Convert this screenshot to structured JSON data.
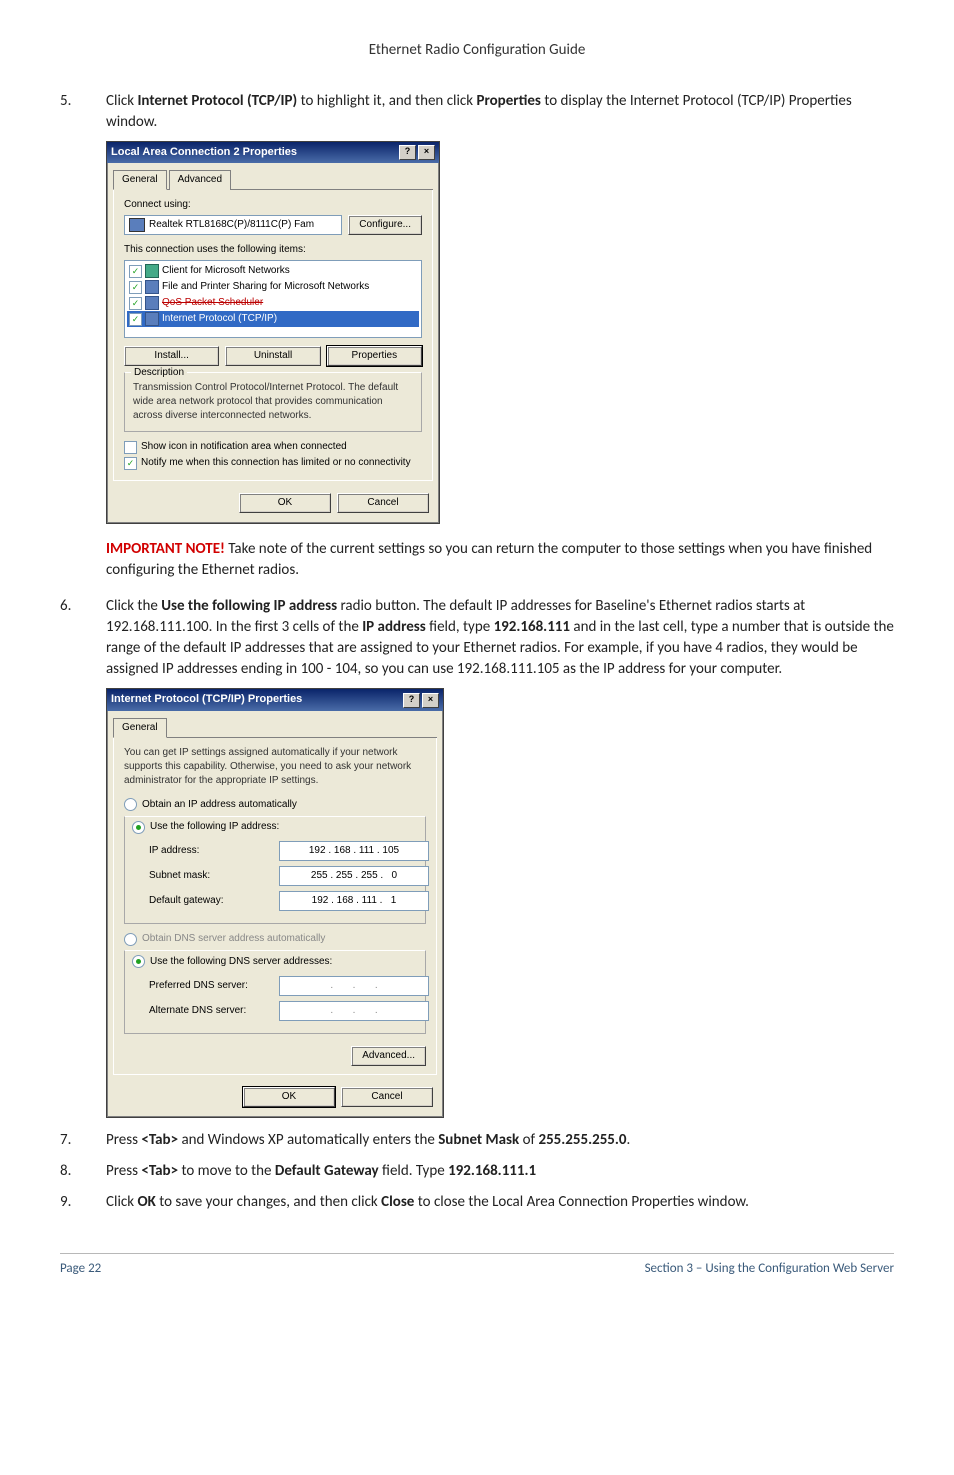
{
  "header": "Ethernet Radio Configuration Guide",
  "step5": {
    "num": "5.",
    "body_pre": "Click ",
    "body_b1": "Internet Protocol (TCP/IP)",
    "body_mid": " to highlight it, and then click ",
    "body_b2": "Properties",
    "body_post": " to display the Internet Protocol (TCP/IP) Properties window."
  },
  "dlg1": {
    "title": "Local Area Connection 2 Properties",
    "tabs": [
      "General",
      "Advanced"
    ],
    "connect_using_lbl": "Connect using:",
    "adapter": "Realtek RTL8168C(P)/8111C(P) Fam",
    "configure_btn": "Configure...",
    "items_lbl": "This connection uses the following items:",
    "items": [
      {
        "text": "Client for Microsoft Networks",
        "checked": true
      },
      {
        "text": "File and Printer Sharing for Microsoft Networks",
        "checked": true
      },
      {
        "text": "QoS Packet Scheduler",
        "checked": true,
        "strike": true
      },
      {
        "text": "Internet Protocol (TCP/IP)",
        "checked": true,
        "selected": true
      }
    ],
    "install_btn": "Install...",
    "uninstall_btn": "Uninstall",
    "properties_btn": "Properties",
    "desc_title": "Description",
    "desc": "Transmission Control Protocol/Internet Protocol. The default wide area network protocol that provides communication across diverse interconnected networks.",
    "cb1": "Show icon in notification area when connected",
    "cb2": "Notify me when this connection has limited or no connectivity",
    "ok": "OK",
    "cancel": "Cancel"
  },
  "important": {
    "label": "IMPORTANT NOTE!",
    "text": " Take note of the current settings so you can return the computer to those settings when you have finished configuring the Ethernet radios."
  },
  "step6": {
    "num": "6.",
    "p1": "Click the ",
    "b1": "Use the following IP address",
    "p2": " radio button. The default IP addresses for Baseline's Ethernet radios starts at 192.168.111.100. In the first 3 cells of the ",
    "b2": "IP address",
    "p3": " field, type ",
    "b3": "192.168.111",
    "p4": " and in the last cell, type a number that is outside the range of the default IP addresses that are assigned to your Ethernet radios. For example, if you have 4 radios, they would be assigned IP addresses ending in 100 - 104, so you can use 192.168.111.105 as the IP address for your computer."
  },
  "dlg2": {
    "title": "Internet Protocol (TCP/IP) Properties",
    "tab": "General",
    "intro": "You can get IP settings assigned automatically if your network supports this capability. Otherwise, you need to ask your network administrator for the appropriate IP settings.",
    "r1": "Obtain an IP address automatically",
    "r2": "Use the following IP address:",
    "ip_lbl": "IP address:",
    "ip_val": "192 . 168 . 111 . 105",
    "mask_lbl": "Subnet mask:",
    "mask_val": "255 . 255 . 255 .   0",
    "gw_lbl": "Default gateway:",
    "gw_val": "192 . 168 . 111 .   1",
    "r3": "Obtain DNS server address automatically",
    "r4": "Use the following DNS server addresses:",
    "dns1_lbl": "Preferred DNS server:",
    "dns2_lbl": "Alternate DNS server:",
    "dns_empty": "   .       .       .   ",
    "adv_btn": "Advanced...",
    "ok": "OK",
    "cancel": "Cancel"
  },
  "step7": {
    "num": "7.",
    "p1": "Press ",
    "b1": "<Tab>",
    "p2": " and Windows XP automatically enters the ",
    "b2": "Subnet Mask",
    "p3": " of ",
    "b3": "255.255.255.0",
    "p4": "."
  },
  "step8": {
    "num": "8.",
    "p1": "Press ",
    "b1": "<Tab>",
    "p2": " to move to the ",
    "b2": "Default Gateway",
    "p3": " field. Type ",
    "b3": "192.168.111.1"
  },
  "step9": {
    "num": "9.",
    "p1": "Click ",
    "b1": "OK",
    "p2": " to save your changes, and then click ",
    "b2": "Close",
    "p3": " to close the Local Area Connection Properties window."
  },
  "footer": {
    "left": "Page 22",
    "right": "Section 3 – Using the Configuration Web Server"
  }
}
